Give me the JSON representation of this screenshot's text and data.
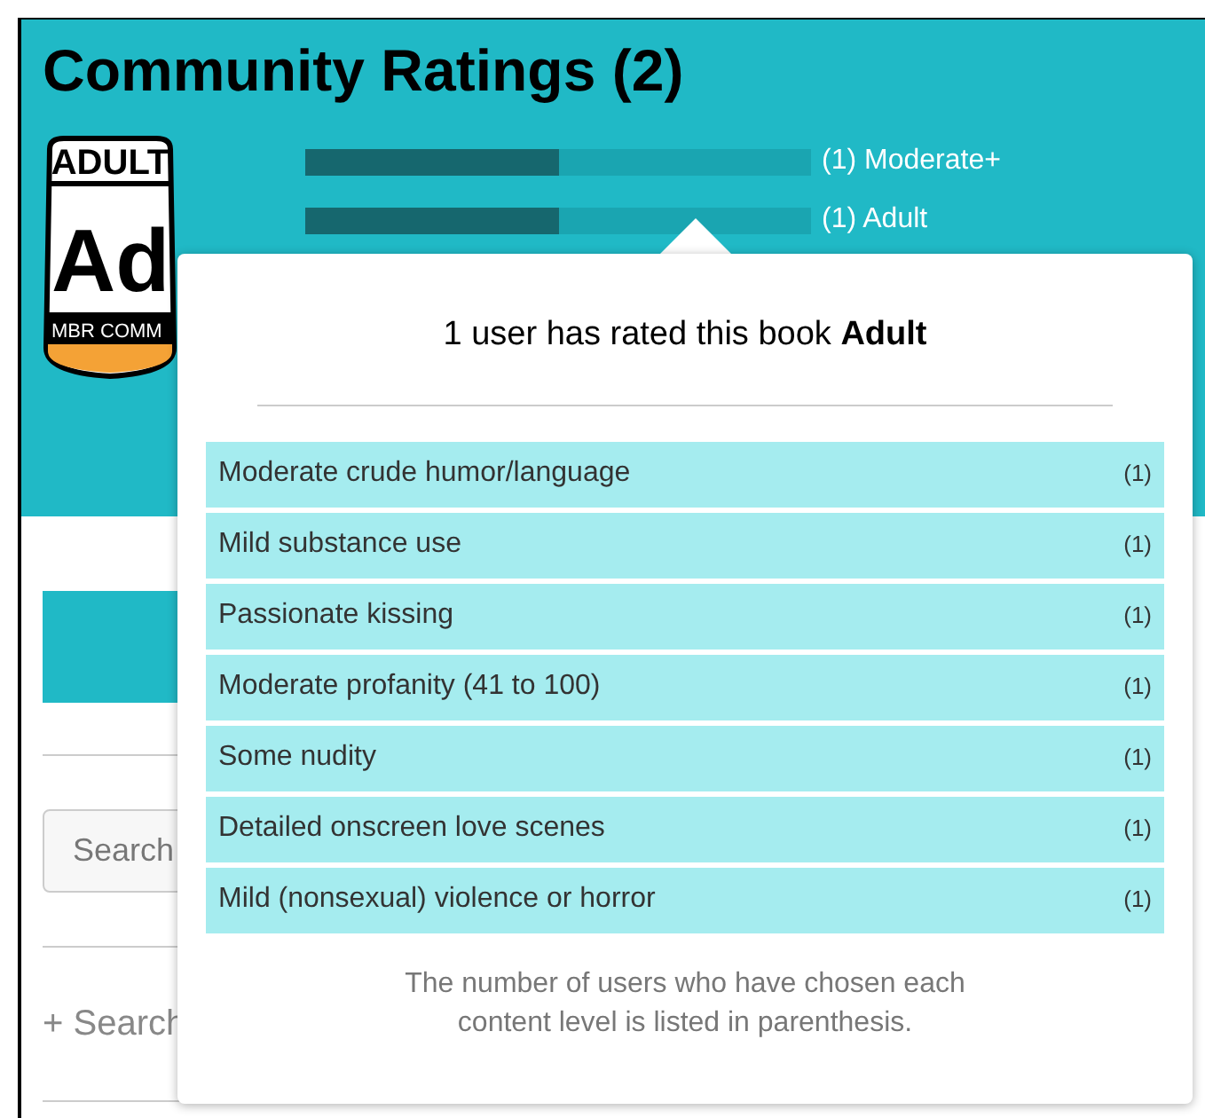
{
  "header": {
    "title": "Community Ratings (2)",
    "badge": {
      "top": "ADULT",
      "symbol": "Ad",
      "bottom": "MBR COMM"
    },
    "ratings": [
      {
        "level": 0.5,
        "label": "(1) Moderate+"
      },
      {
        "level": 0.5,
        "label": "(1) Adult"
      }
    ]
  },
  "sidebar": {
    "search": {
      "placeholder": "Search"
    },
    "link": "+ Search"
  },
  "popup": {
    "title": "1 user has rated this book **Adult**",
    "items": [
      {
        "label": "Moderate crude humor/language",
        "count": "(1)"
      },
      {
        "label": "Mild substance use",
        "count": "(1)"
      },
      {
        "label": "Passionate kissing",
        "count": "(1)"
      },
      {
        "label": "Moderate profanity (41 to 100)",
        "count": "(1)"
      },
      {
        "label": "Some nudity",
        "count": "(1)"
      },
      {
        "label": "Detailed onscreen love scenes",
        "count": "(1)"
      },
      {
        "label": "Mild (nonsexual) violence or horror",
        "count": "(1)"
      }
    ],
    "footer": "The number of users who have chosen each content level is listed in parenthesis."
  }
}
